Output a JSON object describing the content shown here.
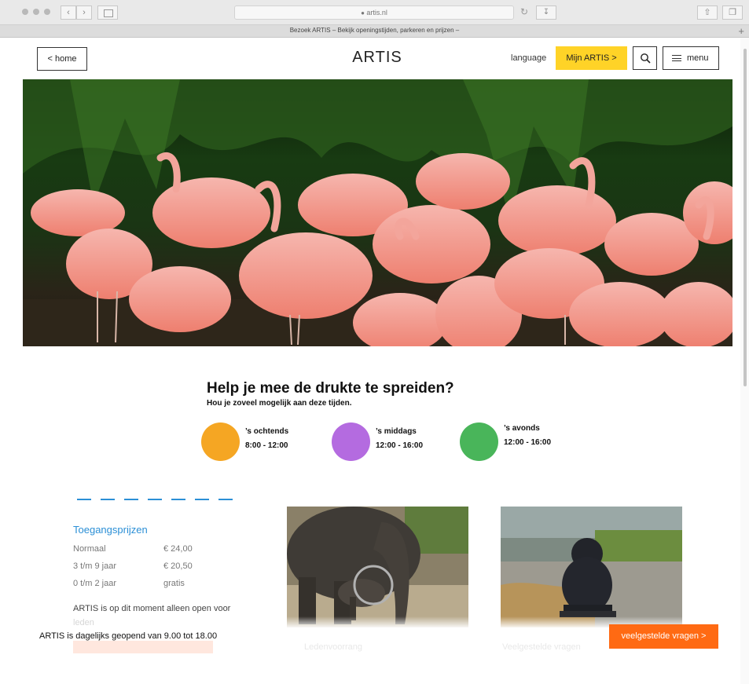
{
  "browser": {
    "url": "artis.nl",
    "tab_title": "Bezoek ARTIS – Bekijk openingstijden, parkeren en prijzen –",
    "back_icon": "chevron-left-icon",
    "forward_icon": "chevron-right-icon",
    "new_tab": "+"
  },
  "header": {
    "home_label": "< home",
    "logo": "ARTIS",
    "language_label": "language",
    "mijn_label": "Mijn ARTIS  >",
    "menu_label": "menu",
    "accent_color": "#ffd327"
  },
  "crowd": {
    "title": "Help je mee de drukte te spreiden?",
    "subtitle": "Hou je zoveel mogelijk aan deze tijden.",
    "slots": [
      {
        "label": "’s ochtends",
        "time": "8:00 - 12:00",
        "color": "#f5a623"
      },
      {
        "label": "’s middags",
        "time": "12:00 - 16:00",
        "color": "#b46be0"
      },
      {
        "label": "’s avonds",
        "time": "12:00 - 16:00",
        "color": "#49b55a"
      }
    ]
  },
  "prices": {
    "title": "Toegangsprijzen",
    "rows": [
      {
        "label": "Normaal",
        "value": "€ 24,00"
      },
      {
        "label": "3 t/m 9 jaar",
        "value": "€ 20,50"
      },
      {
        "label": "0 t/m 2 jaar",
        "value": "gratis"
      }
    ],
    "notice": "ARTIS is op dit moment alleen open voor",
    "notice_faded": "leden"
  },
  "cards": [
    {
      "caption": "Ledenvoorrang"
    },
    {
      "caption": "Veelgestelde vragen"
    }
  ],
  "banner": {
    "open_text": "ARTIS is dagelijks geopend van 9.00 tot 18.00",
    "faq_label": "veelgestelde vragen  >",
    "faq_color": "#ff6a13"
  }
}
